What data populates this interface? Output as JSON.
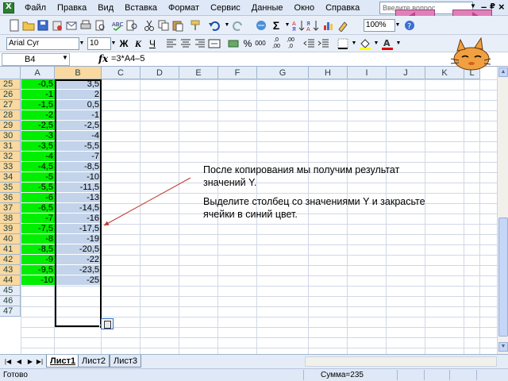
{
  "menu": {
    "items": [
      "Файл",
      "Правка",
      "Вид",
      "Вставка",
      "Формат",
      "Сервис",
      "Данные",
      "Окно",
      "Справка"
    ],
    "ask_placeholder": "Введите вопрос",
    "window_controls": [
      "–",
      "₽",
      "×"
    ]
  },
  "toolbar": {
    "zoom": "100%",
    "font_name": "Arial Cyr",
    "font_size": "10",
    "bold": "Ж",
    "italic": "К",
    "underline": "Ч"
  },
  "formula_bar": {
    "name_box": "B4",
    "fx": "fx",
    "formula": "=3*A4–5"
  },
  "columns": [
    "A",
    "B",
    "C",
    "D",
    "E",
    "F",
    "G",
    "H",
    "I",
    "J",
    "K",
    "L"
  ],
  "rows": [
    {
      "n": "25",
      "a": "-0,5",
      "b": "3,5"
    },
    {
      "n": "26",
      "a": "-1",
      "b": "2"
    },
    {
      "n": "27",
      "a": "-1,5",
      "b": "0,5"
    },
    {
      "n": "28",
      "a": "-2",
      "b": "-1"
    },
    {
      "n": "29",
      "a": "-2,5",
      "b": "-2,5"
    },
    {
      "n": "30",
      "a": "-3",
      "b": "-4"
    },
    {
      "n": "31",
      "a": "-3,5",
      "b": "-5,5"
    },
    {
      "n": "32",
      "a": "-4",
      "b": "-7"
    },
    {
      "n": "33",
      "a": "-4,5",
      "b": "-8,5"
    },
    {
      "n": "34",
      "a": "-5",
      "b": "-10"
    },
    {
      "n": "35",
      "a": "-5,5",
      "b": "-11,5"
    },
    {
      "n": "36",
      "a": "-6",
      "b": "-13"
    },
    {
      "n": "37",
      "a": "-6,5",
      "b": "-14,5"
    },
    {
      "n": "38",
      "a": "-7",
      "b": "-16"
    },
    {
      "n": "39",
      "a": "-7,5",
      "b": "-17,5"
    },
    {
      "n": "40",
      "a": "-8",
      "b": "-19"
    },
    {
      "n": "41",
      "a": "-8,5",
      "b": "-20,5"
    },
    {
      "n": "42",
      "a": "-9",
      "b": "-22"
    },
    {
      "n": "43",
      "a": "-9,5",
      "b": "-23,5"
    },
    {
      "n": "44",
      "a": "-10",
      "b": "-25"
    },
    {
      "n": "45",
      "a": "",
      "b": ""
    },
    {
      "n": "46",
      "a": "",
      "b": ""
    },
    {
      "n": "47",
      "a": "",
      "b": ""
    }
  ],
  "sheets": [
    "Лист1",
    "Лист2",
    "Лист3"
  ],
  "status": {
    "ready": "Готово",
    "sum": "Сумма=235"
  },
  "callout": {
    "line1": "После копирования мы получим результат значений Y.",
    "line2": "Выделите столбец со значениями Y и закрасьте ячейки в синий цвет."
  },
  "colors": {
    "column_a_fill": "#00ee00",
    "column_b_fill": "#c3d3ea",
    "nav_button": "#e080b8"
  }
}
